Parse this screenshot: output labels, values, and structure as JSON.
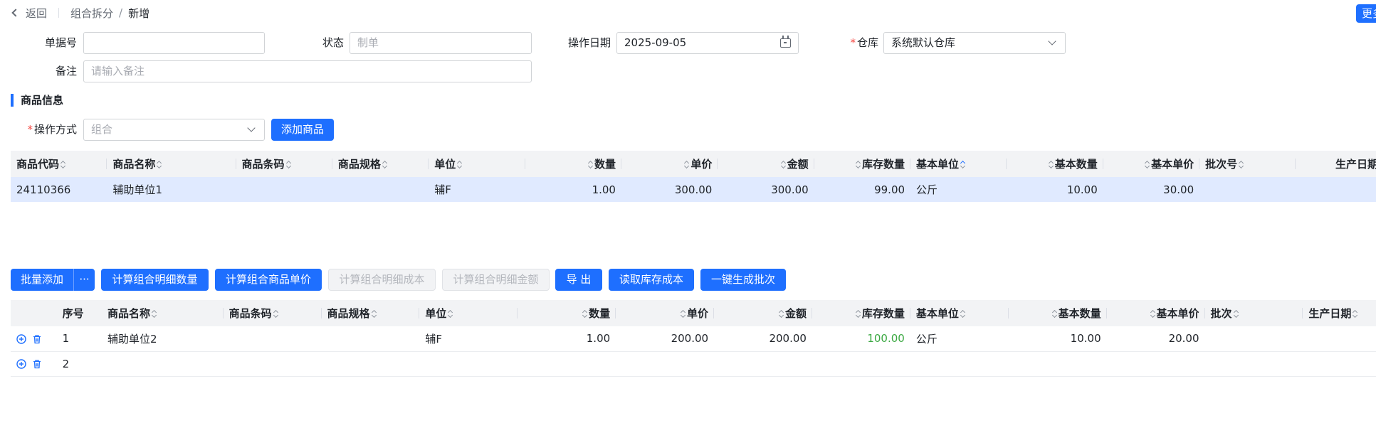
{
  "breadcrumb": {
    "back_label": "返回",
    "level1": "组合拆分",
    "separator": "/",
    "level2": "新增"
  },
  "more_button": {
    "label": "更多"
  },
  "form": {
    "doc_no": {
      "label": "单据号",
      "value": ""
    },
    "status": {
      "label": "状态",
      "placeholder": "制单"
    },
    "op_date": {
      "label": "操作日期",
      "value": "2025-09-05"
    },
    "warehouse": {
      "label": "仓库",
      "value": "系统默认仓库",
      "required": "*"
    },
    "remark": {
      "label": "备注",
      "placeholder": "请输入备注"
    }
  },
  "section": {
    "title": "商品信息"
  },
  "operation": {
    "label": "操作方式",
    "required": "*",
    "placeholder": "组合",
    "add_button": "添加商品"
  },
  "top_table": {
    "columns": [
      "商品代码",
      "商品名称",
      "商品条码",
      "商品规格",
      "单位",
      "数量",
      "单价",
      "金额",
      "库存数量",
      "基本单位",
      "基本数量",
      "基本单价",
      "批次号",
      "生产日期"
    ],
    "rows": [
      {
        "code": "24110366",
        "name": "辅助单位1",
        "barcode": "",
        "spec": "",
        "unit": "辅F",
        "qty": "1.00",
        "price": "300.00",
        "amount": "300.00",
        "stock": "99.00",
        "base_unit": "公斤",
        "base_qty": "10.00",
        "base_price": "30.00",
        "batch": "",
        "prod_date": ""
      }
    ]
  },
  "toolbar": {
    "batch_add": "批量添加",
    "batch_more": "···",
    "calc_detail_qty": "计算组合明细数量",
    "calc_unit_price": "计算组合商品单价",
    "calc_detail_cost": "计算组合明细成本",
    "calc_detail_amount": "计算组合明细金额",
    "export": "导 出",
    "read_stock_cost": "读取库存成本",
    "gen_batch": "一键生成批次"
  },
  "bottom_table": {
    "columns": [
      "序号",
      "商品名称",
      "商品条码",
      "商品规格",
      "单位",
      "数量",
      "单价",
      "金额",
      "库存数量",
      "基本单位",
      "基本数量",
      "基本单价",
      "批次",
      "生产日期"
    ],
    "rows": [
      {
        "no": "1",
        "name": "辅助单位2",
        "barcode": "",
        "spec": "",
        "unit": "辅F",
        "qty": "1.00",
        "price": "200.00",
        "amount": "200.00",
        "stock": "100.00",
        "base_unit": "公斤",
        "base_qty": "10.00",
        "base_price": "20.00",
        "batch": "",
        "prod_date": ""
      },
      {
        "no": "2",
        "name": "",
        "barcode": "",
        "spec": "",
        "unit": "",
        "qty": "",
        "price": "",
        "amount": "",
        "stock": "",
        "base_unit": "",
        "base_qty": "",
        "base_price": "",
        "batch": "",
        "prod_date": ""
      }
    ]
  },
  "colors": {
    "primary": "#1e6fff",
    "stock_positive": "#3aa841",
    "selected_row": "#e0eaff",
    "required": "#f54a45"
  }
}
